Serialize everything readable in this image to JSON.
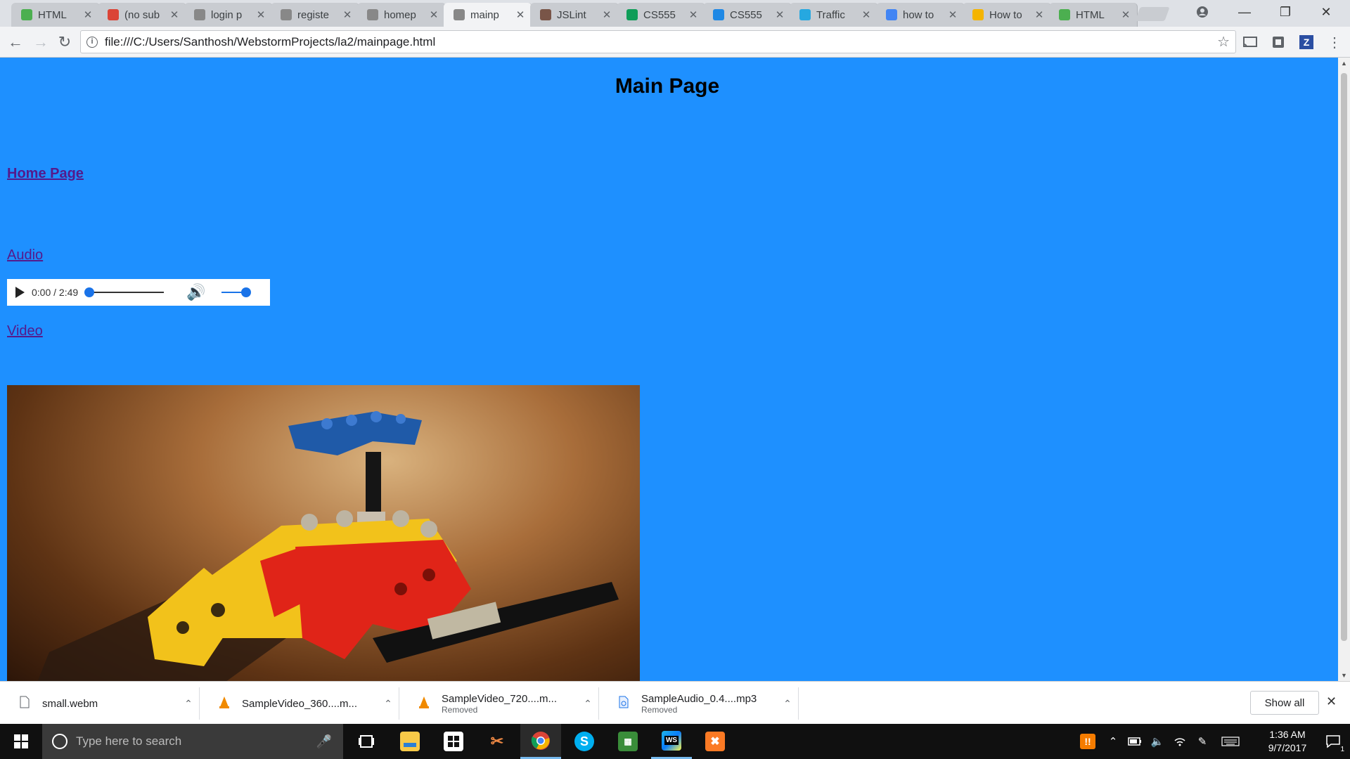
{
  "tabs": [
    {
      "title": "HTML",
      "favicon": "html-icon",
      "color": "#4caf50"
    },
    {
      "title": "(no sub",
      "favicon": "gmail-icon",
      "color": "#db4437"
    },
    {
      "title": "login p",
      "favicon": "page-icon",
      "color": "#888888"
    },
    {
      "title": "registe",
      "favicon": "page-icon",
      "color": "#888888"
    },
    {
      "title": "homep",
      "favicon": "page-icon",
      "color": "#888888"
    },
    {
      "title": "mainp",
      "favicon": "page-icon",
      "color": "#888888",
      "active": true
    },
    {
      "title": "JSLint",
      "favicon": "jslint-icon",
      "color": "#795548"
    },
    {
      "title": "CS555",
      "favicon": "sheets-icon",
      "color": "#0f9d58"
    },
    {
      "title": "CS555",
      "favicon": "box-icon",
      "color": "#1e88e5"
    },
    {
      "title": "Traffic",
      "favicon": "m-icon",
      "color": "#26a8e0"
    },
    {
      "title": "how to",
      "favicon": "google-icon",
      "color": "#4285f4"
    },
    {
      "title": "How to",
      "favicon": "wikihow-icon",
      "color": "#f4b400"
    },
    {
      "title": "HTML",
      "favicon": "html-icon",
      "color": "#4caf50"
    }
  ],
  "address_bar": {
    "url": "file:///C:/Users/Santhosh/WebstormProjects/la2/mainpage.html"
  },
  "page": {
    "title": "Main Page",
    "home_link": "Home Page",
    "audio_link": "Audio",
    "video_link": "Video",
    "background": "#1e90ff",
    "audio_player": {
      "time": "0:00 / 2:49",
      "progress": 0,
      "volume": 1.0
    }
  },
  "downloads": [
    {
      "name": "small.webm",
      "status": "",
      "icon": "file-icon"
    },
    {
      "name": "SampleVideo_360....m...",
      "status": "",
      "icon": "vlc-icon"
    },
    {
      "name": "SampleVideo_720....m...",
      "status": "Removed",
      "icon": "vlc-icon"
    },
    {
      "name": "SampleAudio_0.4....mp3",
      "status": "Removed",
      "icon": "audio-file-icon"
    }
  ],
  "shelf": {
    "show_all": "Show all"
  },
  "taskbar": {
    "search_placeholder": "Type here to search",
    "time": "1:36 AM",
    "date": "9/7/2017",
    "notification_count": "1"
  }
}
